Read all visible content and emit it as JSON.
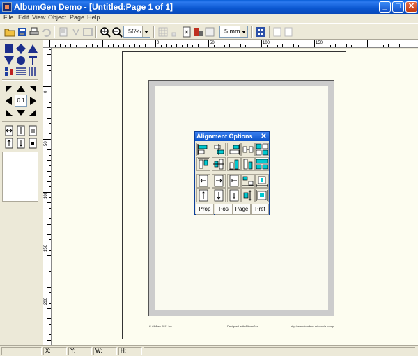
{
  "window": {
    "title": "AlbumGen Demo - [Untitled:Page 1 of 1]"
  },
  "menu": [
    "File",
    "Edit",
    "View",
    "Object",
    "Page",
    "Help"
  ],
  "toolbar": {
    "zoom_value": "56%",
    "grid_value": "5 mm"
  },
  "palette": {
    "step_value": "0.1"
  },
  "ruler": {
    "top_labels": [
      "0",
      "50",
      "100",
      "150"
    ],
    "left_labels": [
      "0",
      "50",
      "100",
      "150",
      "200"
    ]
  },
  "page": {
    "footer_left": "© AlbPen 2011 Inc",
    "footer_center": "Designed with AlbumGen",
    "footer_right": "http://www.iconfem-mi.com/a.comp"
  },
  "dialog": {
    "title": "Alignment Options",
    "close_glyph": "✕",
    "tabs": [
      "Prop",
      "Pos",
      "Page",
      "Pref"
    ]
  },
  "status": {
    "x_label": "X:",
    "y_label": "Y:",
    "w_label": "W:",
    "h_label": "H:"
  },
  "colors": {
    "titlebar": "#0a57d0",
    "canvas": "#fdfdf0",
    "accent_cyan": "#00c8d0"
  }
}
